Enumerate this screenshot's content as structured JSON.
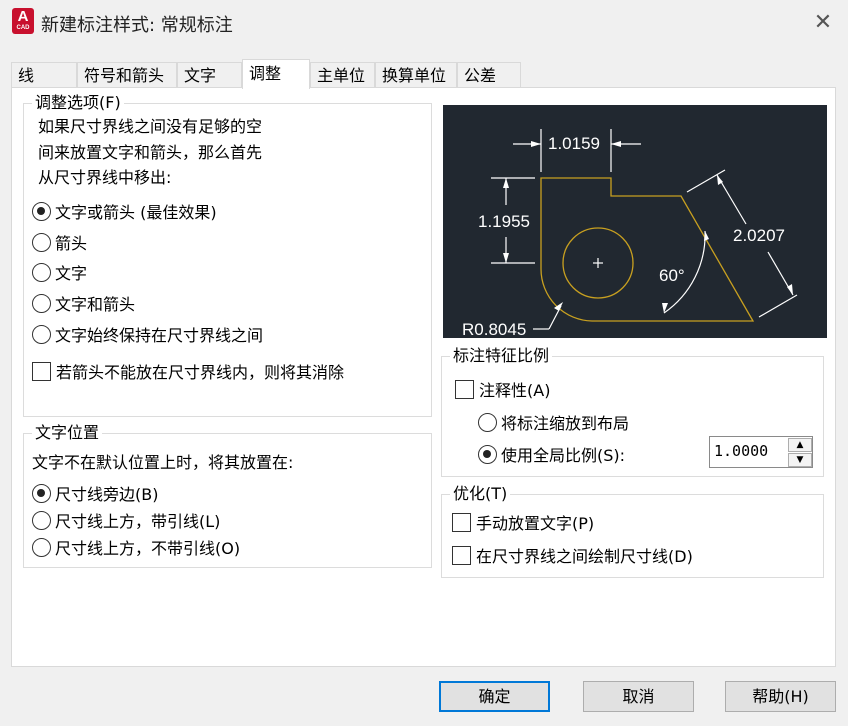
{
  "window": {
    "app_icon_letter": "A",
    "app_icon_sub": "CAD",
    "title": "新建标注样式: 常规标注",
    "close_glyph": "✕"
  },
  "tabs": [
    {
      "label": "线",
      "active": false
    },
    {
      "label": "符号和箭头",
      "active": false
    },
    {
      "label": "文字",
      "active": false
    },
    {
      "label": "调整",
      "active": true
    },
    {
      "label": "主单位",
      "active": false
    },
    {
      "label": "换算单位",
      "active": false
    },
    {
      "label": "公差",
      "active": false
    }
  ],
  "fit_options": {
    "legend": "调整选项(F)",
    "description": [
      "如果尺寸界线之间没有足够的空",
      "间来放置文字和箭头，那么首先",
      "从尺寸界线中移出:"
    ],
    "radios": [
      {
        "label": "文字或箭头 (最佳效果)",
        "selected": true
      },
      {
        "label": "箭头",
        "selected": false
      },
      {
        "label": "文字",
        "selected": false
      },
      {
        "label": "文字和箭头",
        "selected": false
      },
      {
        "label": "文字始终保持在尺寸界线之间",
        "selected": false
      }
    ],
    "suppress_checkbox": {
      "label": "若箭头不能放在尺寸界线内，则将其消除",
      "checked": false
    }
  },
  "text_placement": {
    "legend": "文字位置",
    "description": "文字不在默认位置上时，将其放置在:",
    "radios": [
      {
        "label": "尺寸线旁边(B)",
        "selected": true
      },
      {
        "label": "尺寸线上方，带引线(L)",
        "selected": false
      },
      {
        "label": "尺寸线上方，不带引线(O)",
        "selected": false
      }
    ]
  },
  "preview": {
    "dim_top": "1.0159",
    "dim_left": "1.1955",
    "dim_right": "2.0207",
    "angle": "60°",
    "radius": "R0.8045",
    "bg_color": "#212830",
    "geometry_color": "#c8a020",
    "dim_color": "#ffffff"
  },
  "scale": {
    "legend": "标注特征比例",
    "annotative_checkbox": {
      "label": "注释性(A)",
      "checked": false
    },
    "radios": [
      {
        "label": "将标注缩放到布局",
        "selected": false
      },
      {
        "label": "使用全局比例(S):",
        "selected": true
      }
    ],
    "global_scale_value": "1.0000",
    "spin_up": "▲",
    "spin_down": "▼"
  },
  "fine_tuning": {
    "legend": "优化(T)",
    "checkboxes": [
      {
        "label": "手动放置文字(P)",
        "checked": false
      },
      {
        "label": "在尺寸界线之间绘制尺寸线(D)",
        "checked": false
      }
    ]
  },
  "buttons": {
    "ok": "确定",
    "cancel": "取消",
    "help": "帮助(H)"
  },
  "colors": {
    "accent": "#0078d7",
    "app_red": "#c8102e"
  }
}
